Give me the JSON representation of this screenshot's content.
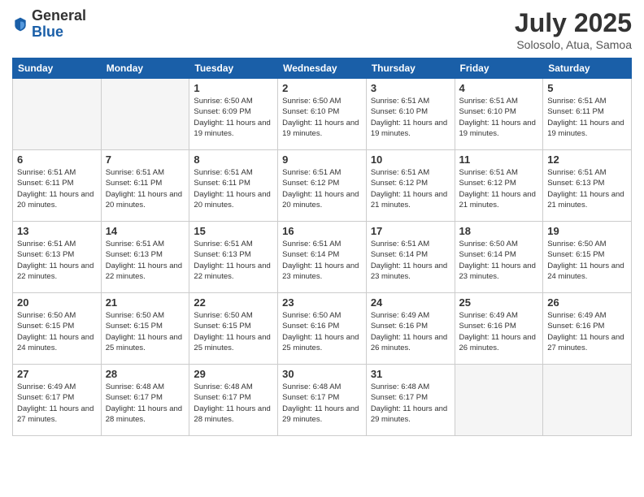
{
  "header": {
    "logo_general": "General",
    "logo_blue": "Blue",
    "title": "July 2025",
    "location": "Solosolo, Atua, Samoa"
  },
  "days_of_week": [
    "Sunday",
    "Monday",
    "Tuesday",
    "Wednesday",
    "Thursday",
    "Friday",
    "Saturday"
  ],
  "weeks": [
    [
      {
        "day": "",
        "empty": true
      },
      {
        "day": "",
        "empty": true
      },
      {
        "day": "1",
        "sunrise": "6:50 AM",
        "sunset": "6:09 PM",
        "daylight": "11 hours and 19 minutes."
      },
      {
        "day": "2",
        "sunrise": "6:50 AM",
        "sunset": "6:10 PM",
        "daylight": "11 hours and 19 minutes."
      },
      {
        "day": "3",
        "sunrise": "6:51 AM",
        "sunset": "6:10 PM",
        "daylight": "11 hours and 19 minutes."
      },
      {
        "day": "4",
        "sunrise": "6:51 AM",
        "sunset": "6:10 PM",
        "daylight": "11 hours and 19 minutes."
      },
      {
        "day": "5",
        "sunrise": "6:51 AM",
        "sunset": "6:11 PM",
        "daylight": "11 hours and 19 minutes."
      }
    ],
    [
      {
        "day": "6",
        "sunrise": "6:51 AM",
        "sunset": "6:11 PM",
        "daylight": "11 hours and 20 minutes."
      },
      {
        "day": "7",
        "sunrise": "6:51 AM",
        "sunset": "6:11 PM",
        "daylight": "11 hours and 20 minutes."
      },
      {
        "day": "8",
        "sunrise": "6:51 AM",
        "sunset": "6:11 PM",
        "daylight": "11 hours and 20 minutes."
      },
      {
        "day": "9",
        "sunrise": "6:51 AM",
        "sunset": "6:12 PM",
        "daylight": "11 hours and 20 minutes."
      },
      {
        "day": "10",
        "sunrise": "6:51 AM",
        "sunset": "6:12 PM",
        "daylight": "11 hours and 21 minutes."
      },
      {
        "day": "11",
        "sunrise": "6:51 AM",
        "sunset": "6:12 PM",
        "daylight": "11 hours and 21 minutes."
      },
      {
        "day": "12",
        "sunrise": "6:51 AM",
        "sunset": "6:13 PM",
        "daylight": "11 hours and 21 minutes."
      }
    ],
    [
      {
        "day": "13",
        "sunrise": "6:51 AM",
        "sunset": "6:13 PM",
        "daylight": "11 hours and 22 minutes."
      },
      {
        "day": "14",
        "sunrise": "6:51 AM",
        "sunset": "6:13 PM",
        "daylight": "11 hours and 22 minutes."
      },
      {
        "day": "15",
        "sunrise": "6:51 AM",
        "sunset": "6:13 PM",
        "daylight": "11 hours and 22 minutes."
      },
      {
        "day": "16",
        "sunrise": "6:51 AM",
        "sunset": "6:14 PM",
        "daylight": "11 hours and 23 minutes."
      },
      {
        "day": "17",
        "sunrise": "6:51 AM",
        "sunset": "6:14 PM",
        "daylight": "11 hours and 23 minutes."
      },
      {
        "day": "18",
        "sunrise": "6:50 AM",
        "sunset": "6:14 PM",
        "daylight": "11 hours and 23 minutes."
      },
      {
        "day": "19",
        "sunrise": "6:50 AM",
        "sunset": "6:15 PM",
        "daylight": "11 hours and 24 minutes."
      }
    ],
    [
      {
        "day": "20",
        "sunrise": "6:50 AM",
        "sunset": "6:15 PM",
        "daylight": "11 hours and 24 minutes."
      },
      {
        "day": "21",
        "sunrise": "6:50 AM",
        "sunset": "6:15 PM",
        "daylight": "11 hours and 25 minutes."
      },
      {
        "day": "22",
        "sunrise": "6:50 AM",
        "sunset": "6:15 PM",
        "daylight": "11 hours and 25 minutes."
      },
      {
        "day": "23",
        "sunrise": "6:50 AM",
        "sunset": "6:16 PM",
        "daylight": "11 hours and 25 minutes."
      },
      {
        "day": "24",
        "sunrise": "6:49 AM",
        "sunset": "6:16 PM",
        "daylight": "11 hours and 26 minutes."
      },
      {
        "day": "25",
        "sunrise": "6:49 AM",
        "sunset": "6:16 PM",
        "daylight": "11 hours and 26 minutes."
      },
      {
        "day": "26",
        "sunrise": "6:49 AM",
        "sunset": "6:16 PM",
        "daylight": "11 hours and 27 minutes."
      }
    ],
    [
      {
        "day": "27",
        "sunrise": "6:49 AM",
        "sunset": "6:17 PM",
        "daylight": "11 hours and 27 minutes."
      },
      {
        "day": "28",
        "sunrise": "6:48 AM",
        "sunset": "6:17 PM",
        "daylight": "11 hours and 28 minutes."
      },
      {
        "day": "29",
        "sunrise": "6:48 AM",
        "sunset": "6:17 PM",
        "daylight": "11 hours and 28 minutes."
      },
      {
        "day": "30",
        "sunrise": "6:48 AM",
        "sunset": "6:17 PM",
        "daylight": "11 hours and 29 minutes."
      },
      {
        "day": "31",
        "sunrise": "6:48 AM",
        "sunset": "6:17 PM",
        "daylight": "11 hours and 29 minutes."
      },
      {
        "day": "",
        "empty": true
      },
      {
        "day": "",
        "empty": true
      }
    ]
  ]
}
